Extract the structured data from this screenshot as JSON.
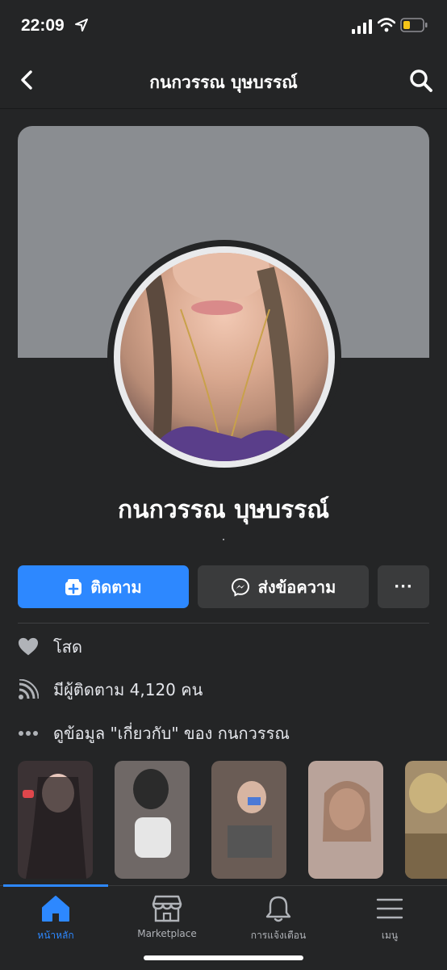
{
  "status": {
    "time": "22:09"
  },
  "nav": {
    "title": "กนกวรรณ บุษบรรณ์"
  },
  "profile": {
    "name": "กนกวรรณ บุษบรรณ์",
    "subtitle": "."
  },
  "actions": {
    "follow_label": "ติดตาม",
    "message_label": "ส่งข้อความ",
    "more_label": "···"
  },
  "info": {
    "relationship": "โสด",
    "followers": "มีผู้ติดตาม 4,120 คน",
    "about": "ดูข้อมูล \"เกี่ยวกับ\" ของ กนกวรรณ"
  },
  "stories": [
    {
      "name": "story-1",
      "color": "#3b3234"
    },
    {
      "name": "story-2",
      "color": "#6f6866"
    },
    {
      "name": "story-3",
      "color": "#6a5c55"
    },
    {
      "name": "story-4",
      "color": "#b9a39a"
    },
    {
      "name": "story-5",
      "color": "#a48e6c"
    }
  ],
  "tabs": [
    {
      "label": "หน้าหลัก",
      "icon": "home-icon"
    },
    {
      "label": "Marketplace",
      "icon": "marketplace-icon"
    },
    {
      "label": "การแจ้งเตือน",
      "icon": "bell-icon"
    },
    {
      "label": "เมนู",
      "icon": "menu-icon"
    }
  ],
  "colors": {
    "accent": "#2d88ff",
    "background": "#242526",
    "button": "#3a3b3c"
  }
}
